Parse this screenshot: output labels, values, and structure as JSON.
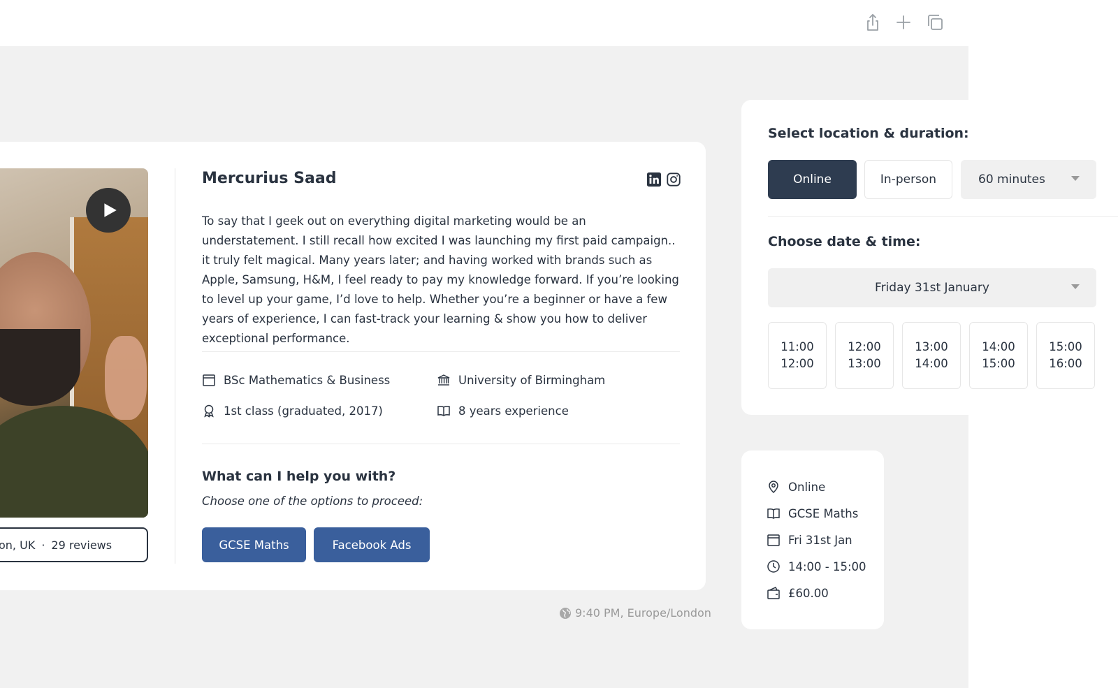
{
  "tutor": {
    "name": "Mercurius Saad",
    "location_fragment": "on, UK",
    "separator": "·",
    "reviews": "29 reviews",
    "bio": "To say that I geek out on everything digital marketing would be an understatement. I still recall how excited I was launching my first paid campaign.. it truly felt magical. Many years later; and having worked with brands such as Apple, Samsung, H&M, I feel ready to pay my knowledge forward. If you’re looking to level up your game, I’d love to help. Whether you’re a beginner or have a few years of experience, I can fast-track your learning & show you how to deliver exceptional performance.",
    "facts": {
      "degree": "BSc Mathematics & Business",
      "university": "University of Birmingham",
      "grade": "1st class (graduated, 2017)",
      "experience": "8 years experience"
    },
    "socials": {
      "linkedin": "linkedin-icon",
      "instagram": "instagram-icon"
    }
  },
  "help": {
    "title": "What can I help you with?",
    "subtitle": "Choose one of the options to proceed:",
    "options": [
      "GCSE Maths",
      "Facebook Ads"
    ]
  },
  "timezone": "9:40 PM, Europe/London",
  "booking": {
    "location_title": "Select location & duration:",
    "modes": [
      "Online",
      "In-person"
    ],
    "active_mode": "Online",
    "duration": "60 minutes",
    "date_title": "Choose date & time:",
    "date": "Friday 31st January",
    "slots": [
      {
        "start": "11:00",
        "end": "12:00"
      },
      {
        "start": "12:00",
        "end": "13:00"
      },
      {
        "start": "13:00",
        "end": "14:00"
      },
      {
        "start": "14:00",
        "end": "15:00"
      },
      {
        "start": "15:00",
        "end": "16:00"
      }
    ]
  },
  "summary": {
    "mode": "Online",
    "subject": "GCSE Maths",
    "date": "Fri 31st Jan",
    "time": "14:00 - 15:00",
    "price": "£60.00"
  },
  "colors": {
    "primary_button": "#3a5f9c",
    "dark_button": "#2e3c50",
    "text": "#2a3340",
    "background": "#f1f1f1"
  }
}
